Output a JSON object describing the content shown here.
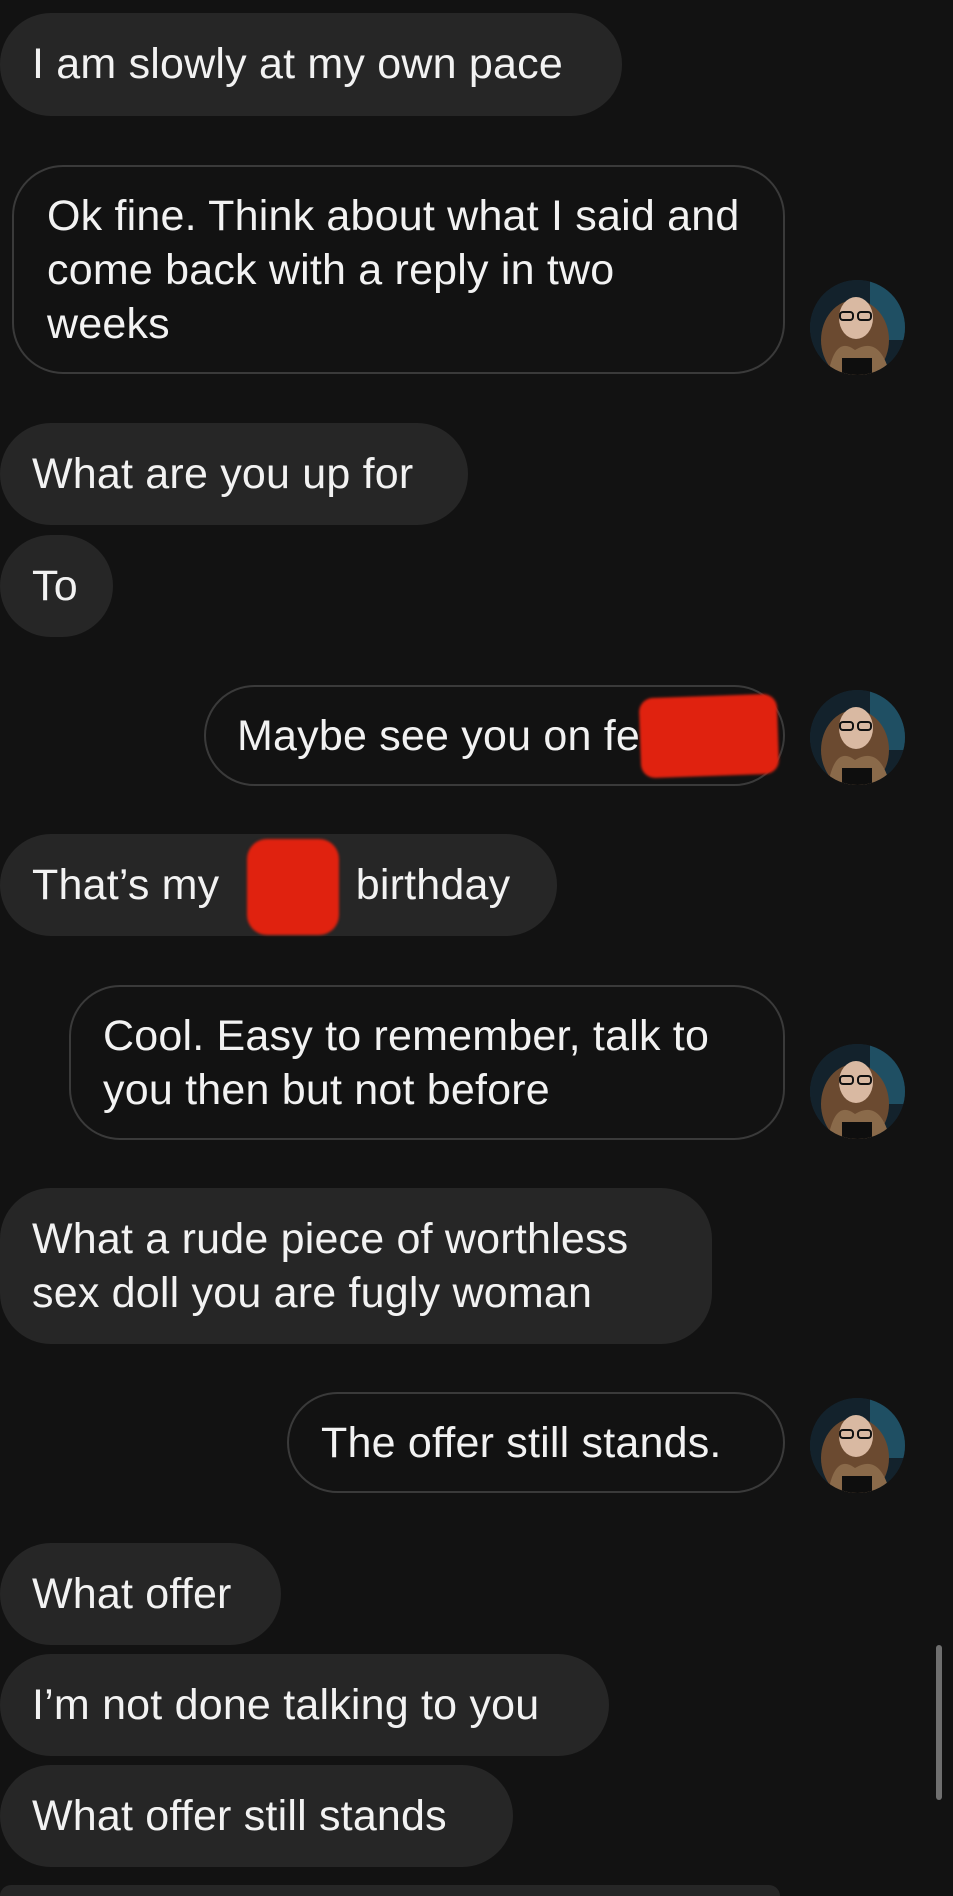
{
  "conversation": {
    "messages": [
      {
        "id": "m1",
        "direction": "incoming",
        "text": "I am slowly at my own pace"
      },
      {
        "id": "m2",
        "direction": "outgoing",
        "text": "Ok fine. Think about what I said and come back with a reply in two weeks"
      },
      {
        "id": "m3",
        "direction": "incoming",
        "text": "What are you up for"
      },
      {
        "id": "m4",
        "direction": "incoming",
        "text": "To"
      },
      {
        "id": "m5",
        "direction": "outgoing",
        "text": "Maybe see you on fe",
        "redacted": true
      },
      {
        "id": "m6",
        "direction": "incoming",
        "text_before": "That’s my",
        "text_after": "birthday",
        "redacted": true
      },
      {
        "id": "m7",
        "direction": "outgoing",
        "text": "Cool. Easy to remember, talk to you then but not before"
      },
      {
        "id": "m8",
        "direction": "incoming",
        "text": "What a rude piece of worthless sex doll you are fugly woman"
      },
      {
        "id": "m9",
        "direction": "outgoing",
        "text": "The offer still stands."
      },
      {
        "id": "m10",
        "direction": "incoming",
        "text": "What offer"
      },
      {
        "id": "m11",
        "direction": "incoming",
        "text": "I’m not done talking to you"
      },
      {
        "id": "m12",
        "direction": "incoming",
        "text": "What offer still stands"
      }
    ]
  },
  "colors": {
    "background": "#121212",
    "incoming_bubble": "#262626",
    "outgoing_border": "#3a3a3a",
    "text": "#f2f2f2",
    "redaction": "#e0220f"
  },
  "icons": {
    "avatar": "user-avatar-photo"
  }
}
